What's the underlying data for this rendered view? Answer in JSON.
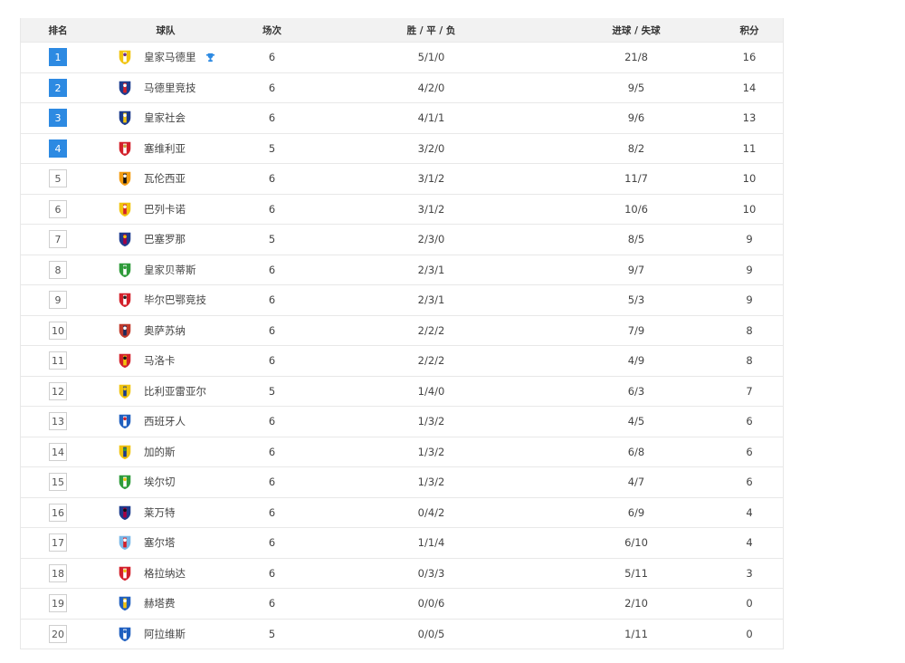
{
  "headers": {
    "rank": "排名",
    "team": "球队",
    "played": "场次",
    "wdl": "胜 / 平 / 负",
    "goals": "进球 / 失球",
    "points": "积分"
  },
  "colors": {
    "accent": "#2d8ae2",
    "trophy": "#2d8ae2"
  },
  "rows": [
    {
      "rank": "1",
      "team": "皇家马德里",
      "played": "6",
      "wdl": "5/1/0",
      "goals": "21/8",
      "points": "16",
      "logo": "real-madrid-crest-icon",
      "logo_colors": [
        "#f1c40f",
        "#ffffff",
        "#6b2c91"
      ],
      "trophy": true
    },
    {
      "rank": "2",
      "team": "马德里竞技",
      "played": "6",
      "wdl": "4/2/0",
      "goals": "9/5",
      "points": "14",
      "logo": "atletico-madrid-crest-icon",
      "logo_colors": [
        "#1b3d8f",
        "#d3202a",
        "#ffffff"
      ]
    },
    {
      "rank": "3",
      "team": "皇家社会",
      "played": "6",
      "wdl": "4/1/1",
      "goals": "9/6",
      "points": "13",
      "logo": "real-sociedad-crest-icon",
      "logo_colors": [
        "#1b3a8c",
        "#f1c40f",
        "#ffffff"
      ]
    },
    {
      "rank": "4",
      "team": "塞维利亚",
      "played": "5",
      "wdl": "3/2/0",
      "goals": "8/2",
      "points": "11",
      "logo": "sevilla-crest-icon",
      "logo_colors": [
        "#d3202a",
        "#ffffff",
        "#c8a43c"
      ]
    },
    {
      "rank": "5",
      "team": "瓦伦西亚",
      "played": "6",
      "wdl": "3/1/2",
      "goals": "11/7",
      "points": "10",
      "logo": "valencia-crest-icon",
      "logo_colors": [
        "#f39c12",
        "#111111",
        "#ffffff"
      ]
    },
    {
      "rank": "6",
      "team": "巴列卡诺",
      "played": "6",
      "wdl": "3/1/2",
      "goals": "10/6",
      "points": "10",
      "logo": "rayo-vallecano-crest-icon",
      "logo_colors": [
        "#f1c40f",
        "#d3202a",
        "#ffffff"
      ]
    },
    {
      "rank": "7",
      "team": "巴塞罗那",
      "played": "5",
      "wdl": "2/3/0",
      "goals": "8/5",
      "points": "9",
      "logo": "barcelona-crest-icon",
      "logo_colors": [
        "#1d3b8f",
        "#a50044",
        "#f1c40f"
      ]
    },
    {
      "rank": "8",
      "team": "皇家贝蒂斯",
      "played": "6",
      "wdl": "2/3/1",
      "goals": "9/7",
      "points": "9",
      "logo": "real-betis-crest-icon",
      "logo_colors": [
        "#2e9b3a",
        "#ffffff",
        "#2e9b3a"
      ]
    },
    {
      "rank": "9",
      "team": "毕尔巴鄂竞技",
      "played": "6",
      "wdl": "2/3/1",
      "goals": "5/3",
      "points": "9",
      "logo": "athletic-bilbao-crest-icon",
      "logo_colors": [
        "#d3202a",
        "#ffffff",
        "#222222"
      ]
    },
    {
      "rank": "10",
      "team": "奥萨苏纳",
      "played": "6",
      "wdl": "2/2/2",
      "goals": "7/9",
      "points": "8",
      "logo": "osasuna-crest-icon",
      "logo_colors": [
        "#c0392b",
        "#1b2a5c",
        "#ffffff"
      ]
    },
    {
      "rank": "11",
      "team": "马洛卡",
      "played": "6",
      "wdl": "2/2/2",
      "goals": "4/9",
      "points": "8",
      "logo": "mallorca-crest-icon",
      "logo_colors": [
        "#d3202a",
        "#f1c40f",
        "#111111"
      ]
    },
    {
      "rank": "12",
      "team": "比利亚雷亚尔",
      "played": "5",
      "wdl": "1/4/0",
      "goals": "6/3",
      "points": "7",
      "logo": "villarreal-crest-icon",
      "logo_colors": [
        "#f1c40f",
        "#1b3a8c",
        "#f1c40f"
      ]
    },
    {
      "rank": "13",
      "team": "西班牙人",
      "played": "6",
      "wdl": "1/3/2",
      "goals": "4/5",
      "points": "6",
      "logo": "espanyol-crest-icon",
      "logo_colors": [
        "#1f5fbf",
        "#ffffff",
        "#d3202a"
      ]
    },
    {
      "rank": "14",
      "team": "加的斯",
      "played": "6",
      "wdl": "1/3/2",
      "goals": "6/8",
      "points": "6",
      "logo": "cadiz-crest-icon",
      "logo_colors": [
        "#f1c40f",
        "#1b3a8c",
        "#2e9b3a"
      ]
    },
    {
      "rank": "15",
      "team": "埃尔切",
      "played": "6",
      "wdl": "1/3/2",
      "goals": "4/7",
      "points": "6",
      "logo": "elche-crest-icon",
      "logo_colors": [
        "#2e9b3a",
        "#ffffff",
        "#f1c40f"
      ]
    },
    {
      "rank": "16",
      "team": "莱万特",
      "played": "6",
      "wdl": "0/4/2",
      "goals": "6/9",
      "points": "4",
      "logo": "levante-crest-icon",
      "logo_colors": [
        "#1b3a8c",
        "#a50044",
        "#111111"
      ]
    },
    {
      "rank": "17",
      "team": "塞尔塔",
      "played": "6",
      "wdl": "1/1/4",
      "goals": "6/10",
      "points": "4",
      "logo": "celta-vigo-crest-icon",
      "logo_colors": [
        "#7ab8e8",
        "#d3202a",
        "#ffffff"
      ]
    },
    {
      "rank": "18",
      "team": "格拉纳达",
      "played": "6",
      "wdl": "0/3/3",
      "goals": "5/11",
      "points": "3",
      "logo": "granada-crest-icon",
      "logo_colors": [
        "#d3202a",
        "#ffffff",
        "#f1c40f"
      ]
    },
    {
      "rank": "19",
      "team": "赫塔费",
      "played": "6",
      "wdl": "0/0/6",
      "goals": "2/10",
      "points": "0",
      "logo": "getafe-crest-icon",
      "logo_colors": [
        "#1f5fbf",
        "#f1c40f",
        "#ffffff"
      ]
    },
    {
      "rank": "20",
      "team": "阿拉维斯",
      "played": "5",
      "wdl": "0/0/5",
      "goals": "1/11",
      "points": "0",
      "logo": "alaves-crest-icon",
      "logo_colors": [
        "#1f5fbf",
        "#ffffff",
        "#1f5fbf"
      ]
    }
  ]
}
